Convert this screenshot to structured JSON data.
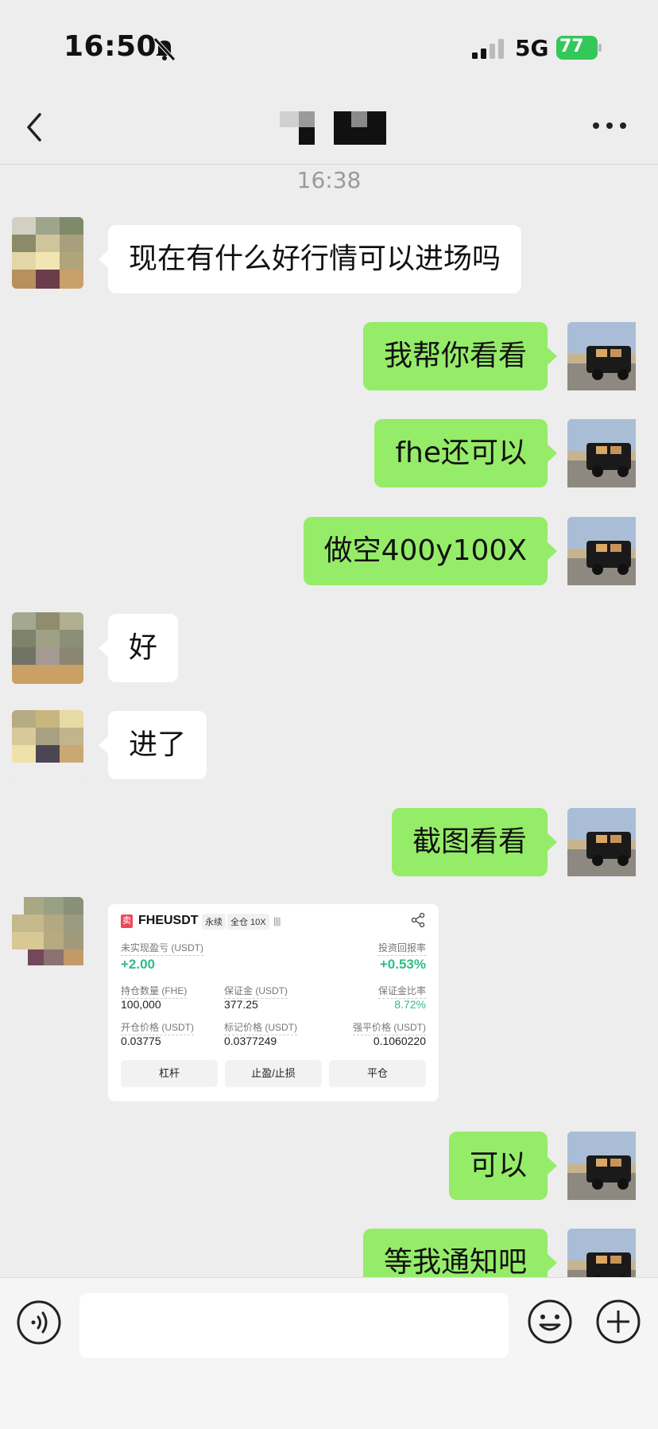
{
  "status_bar": {
    "time": "16:50",
    "network": "5G",
    "battery": "77"
  },
  "nav": {
    "back_icon": "chevron-left-icon",
    "more_icon": "more-dots-icon"
  },
  "chat": {
    "timestamp": "16:38",
    "messages": [
      {
        "side": "left",
        "text": "现在有什么好行情可以进场吗"
      },
      {
        "side": "right",
        "text": "我帮你看看"
      },
      {
        "side": "right",
        "text": "fhe还可以"
      },
      {
        "side": "right",
        "text": "做空400y100X"
      },
      {
        "side": "left",
        "text": "好"
      },
      {
        "side": "left",
        "text": "进了"
      },
      {
        "side": "right",
        "text": "截图看看"
      },
      {
        "side": "right",
        "text": "可以"
      },
      {
        "side": "right",
        "text": "等我通知吧"
      }
    ]
  },
  "trade_card": {
    "sell_badge": "卖",
    "symbol": "FHEUSDT",
    "type_tag": "永续",
    "margin_tag": "全仓 10X",
    "bars": "||||",
    "unrealized_pnl_label": "未实现盈亏 (USDT)",
    "unrealized_pnl": "+2.00",
    "roi_label": "投资回报率",
    "roi": "+0.53%",
    "position_label": "持仓数量 (FHE)",
    "position": "100,000",
    "margin_label": "保证金 (USDT)",
    "margin": "377.25",
    "margin_ratio_label": "保证金比率",
    "margin_ratio": "8.72%",
    "entry_price_label": "开仓价格 (USDT)",
    "entry_price": "0.03775",
    "mark_price_label": "标记价格 (USDT)",
    "mark_price": "0.0377249",
    "liq_price_label": "强平价格 (USDT)",
    "liq_price": "0.1060220",
    "buttons": [
      "杠杆",
      "止盈/止损",
      "平仓"
    ]
  },
  "colors": {
    "background": "#ededed",
    "right_bubble": "#95ec69",
    "left_bubble": "#ffffff",
    "profit_green": "#2ebd85"
  }
}
